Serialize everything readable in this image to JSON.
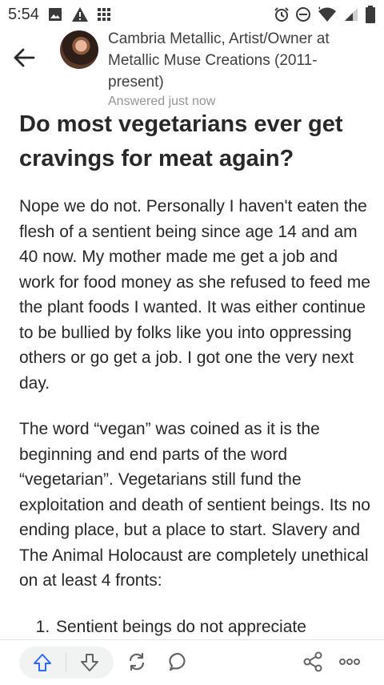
{
  "status_bar": {
    "time": "5:54",
    "left_icons": [
      "image-icon",
      "warning-icon",
      "grid-icon"
    ],
    "right_icons": [
      "alarm-icon",
      "dnd-icon",
      "wifi-icon",
      "signal-icon",
      "battery-icon"
    ]
  },
  "header": {
    "back_icon": "back-arrow-icon",
    "author_credential": "Cambria Metallic, Artist/Owner at Metallic Muse Creations (2011-present)",
    "answered": "Answered just now"
  },
  "question": {
    "title": "Do most vegetarians ever get cravings for meat again?"
  },
  "answer": {
    "paragraphs": [
      "Nope we do not. Personally I haven't eaten the flesh of a sentient being since age 14 and am 40 now. My mother made me get a job and work for food money as she refused to feed me the plant foods I wanted. It was either continue to be bullied by folks like you into oppressing others or go get a job. I got one the very next day.",
      "The word “vegan” was coined as it is the beginning and end parts of the word “vegetarian”. Vegetarians still fund the exploitation and death of sentient beings. Its no ending place, but a place to start. Slavery and The Animal Holocaust are completely unethical on at least 4 fronts:"
    ],
    "list_items": [
      "Sentient beings do not appreciate"
    ]
  },
  "action_bar": {
    "icons": [
      "upvote-icon",
      "downvote-icon",
      "share-reshare-icon",
      "comment-icon",
      "share-icon",
      "more-icon"
    ],
    "accent": "#2e69ff"
  }
}
